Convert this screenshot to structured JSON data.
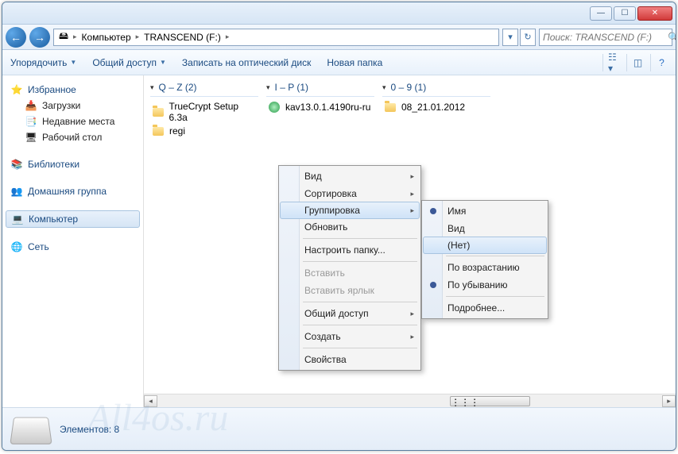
{
  "titlebar": {
    "min": "—",
    "max": "☐",
    "close": "✕"
  },
  "nav": {
    "back": "←",
    "fwd": "→",
    "segments": [
      "Компьютер",
      "TRANSCEND (F:)"
    ],
    "refresh": "↻",
    "dropdown": "▾"
  },
  "search": {
    "placeholder": "Поиск: TRANSCEND (F:)",
    "mag": "🔍"
  },
  "toolbar": {
    "organize": "Упорядочить",
    "share": "Общий доступ",
    "burn": "Записать на оптический диск",
    "newfolder": "Новая папка"
  },
  "sidebar": {
    "fav": {
      "label": "Избранное",
      "items": [
        "Загрузки",
        "Недавние места",
        "Рабочий стол"
      ]
    },
    "lib": {
      "label": "Библиотеки"
    },
    "home": {
      "label": "Домашняя группа"
    },
    "comp": {
      "label": "Компьютер"
    },
    "net": {
      "label": "Сеть"
    }
  },
  "groups": [
    {
      "label": "Q – Z (2)",
      "items": [
        {
          "name": "TrueCrypt Setup 6.3a",
          "icon": "folder"
        },
        {
          "name": "regi",
          "icon": "folder"
        }
      ]
    },
    {
      "label": "I – P (1)",
      "items": [
        {
          "name": "kav13.0.1.4190ru-ru",
          "icon": "disk"
        }
      ]
    },
    {
      "label": "0 – 9 (1)",
      "items": [
        {
          "name": "08_21.01.2012",
          "icon": "folder"
        }
      ]
    }
  ],
  "ctx1": {
    "view": "Вид",
    "sort": "Сортировка",
    "group": "Группировка",
    "refresh": "Обновить",
    "customize": "Настроить папку...",
    "paste": "Вставить",
    "pastelink": "Вставить ярлык",
    "share": "Общий доступ",
    "create": "Создать",
    "props": "Свойства"
  },
  "ctx2": {
    "name": "Имя",
    "view": "Вид",
    "none": "(Нет)",
    "asc": "По возрастанию",
    "desc": "По убыванию",
    "more": "Подробнее..."
  },
  "status": {
    "count_label": "Элементов:",
    "count": "8"
  },
  "watermark": "All4os.ru"
}
